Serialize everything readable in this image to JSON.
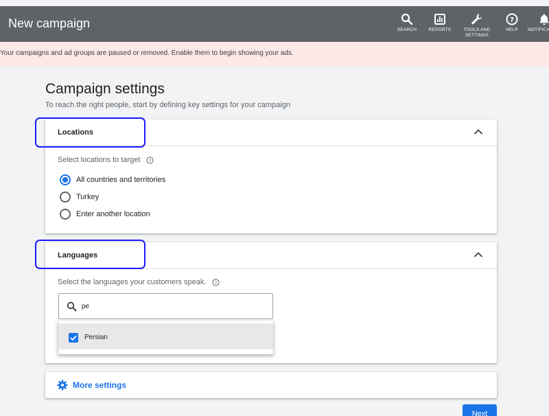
{
  "header": {
    "title": "New campaign",
    "nav": [
      {
        "label": "SEARCH",
        "icon": "search-icon"
      },
      {
        "label": "REPORTS",
        "icon": "reports-icon"
      },
      {
        "label": "TOOLS AND SETTINGS",
        "icon": "wrench-icon"
      },
      {
        "label": "HELP",
        "icon": "help-icon"
      },
      {
        "label": "NOTIFICATIONS",
        "icon": "bell-icon"
      }
    ]
  },
  "banner": {
    "text": "Your campaigns and ad groups are paused or removed. Enable them to begin showing your ads."
  },
  "page": {
    "title": "Campaign settings",
    "subtitle": "To reach the right people, start by defining key settings for your campaign"
  },
  "locations": {
    "heading": "Locations",
    "prompt": "Select locations to target",
    "options": [
      {
        "label": "All countries and territories",
        "selected": true
      },
      {
        "label": "Turkey",
        "selected": false
      },
      {
        "label": "Enter another location",
        "selected": false
      }
    ]
  },
  "languages": {
    "heading": "Languages",
    "prompt": "Select the languages your customers speak.",
    "search_value": "pe",
    "dropdown": [
      {
        "label": "Persian",
        "checked": true
      }
    ]
  },
  "more_settings": {
    "label": "More settings"
  },
  "footer": {
    "next_label": "Next"
  },
  "colors": {
    "accent": "#1a73e8",
    "header": "#5f6368",
    "banner": "#fce8e6",
    "highlight": "#1a1aff"
  }
}
